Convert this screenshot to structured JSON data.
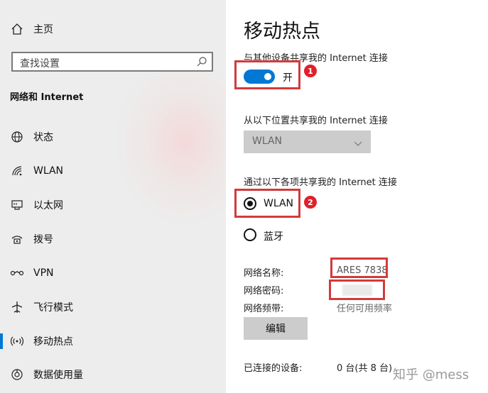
{
  "sidebar": {
    "home_label": "主页",
    "search_placeholder": "查找设置",
    "section_title": "网络和 Internet",
    "items": [
      {
        "label": "状态",
        "icon": "globe-icon"
      },
      {
        "label": "WLAN",
        "icon": "wifi-icon"
      },
      {
        "label": "以太网",
        "icon": "ethernet-icon"
      },
      {
        "label": "拨号",
        "icon": "dialup-icon"
      },
      {
        "label": "VPN",
        "icon": "vpn-icon"
      },
      {
        "label": "飞行模式",
        "icon": "airplane-icon"
      },
      {
        "label": "移动热点",
        "icon": "hotspot-icon"
      },
      {
        "label": "数据使用量",
        "icon": "data-usage-icon"
      }
    ],
    "active_item": "移动热点"
  },
  "main": {
    "title": "移动热点",
    "share_label": "与其他设备共享我的 Internet 连接",
    "toggle_state": "开",
    "toggle_on": true,
    "share_from_label": "从以下位置共享我的 Internet 连接",
    "share_from_value": "WLAN",
    "share_over_label": "通过以下各项共享我的 Internet 连接",
    "options": [
      {
        "label": "WLAN",
        "selected": true
      },
      {
        "label": "蓝牙",
        "selected": false
      }
    ],
    "network_name_label": "网络名称:",
    "network_name_value": "ARES 7838",
    "network_password_label": "网络密码:",
    "network_band_label": "网络频带:",
    "network_band_value": "任何可用频率",
    "edit_button": "编辑",
    "connected_label": "已连接的设备:",
    "connected_value": "0 台(共 8 台)"
  },
  "annotations": {
    "badge_1": "1",
    "badge_2": "2",
    "highlight_color": "#d33a3a"
  },
  "watermark": "知乎 @mess",
  "colors": {
    "accent": "#0078d4",
    "badge": "#e0202a"
  }
}
